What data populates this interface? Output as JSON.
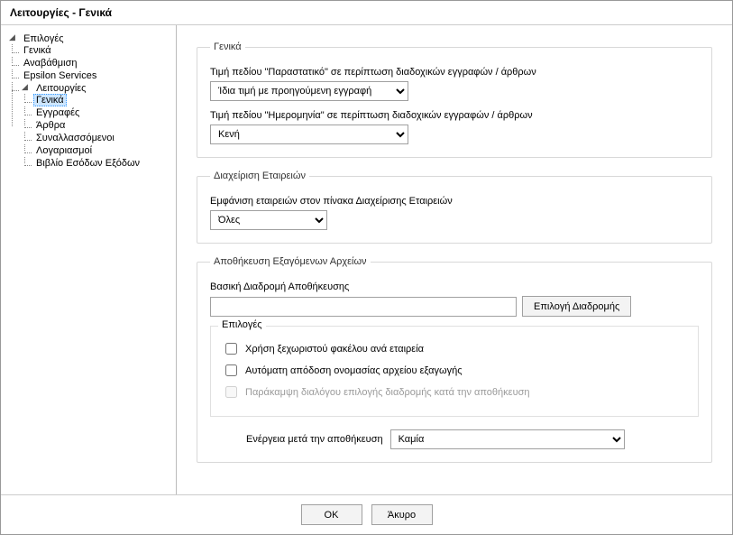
{
  "title": "Λειτουργίες - Γενικά",
  "tree": {
    "root": "Επιλογές",
    "items": {
      "genika": "Γενικά",
      "anavathmisi": "Αναβάθμιση",
      "epsilon": "Epsilon Services",
      "leitourgies": "Λειτουργίες",
      "l_genika": "Γενικά",
      "l_eggrafes": "Εγγραφές",
      "l_arthra": "Άρθρα",
      "l_synal": "Συναλλασσόμενοι",
      "l_logar": "Λογαριασμοί",
      "l_vivlio": "Βιβλίο Εσόδων Εξόδων"
    }
  },
  "general": {
    "legend": "Γενικά",
    "parastatiko_label": "Τιμή πεδίου \"Παραστατικό\" σε περίπτωση διαδοχικών εγγραφών / άρθρων",
    "parastatiko_value": "Ίδια τιμή με προηγούμενη εγγραφή",
    "imerominia_label": "Τιμή πεδίου \"Ημερομηνία\" σε περίπτωση διαδοχικών εγγραφών / άρθρων",
    "imerominia_value": "Κενή"
  },
  "companies": {
    "legend": "Διαχείριση Εταιρειών",
    "show_label": "Εμφάνιση εταιρειών στον πίνακα Διαχείρισης Εταιρειών",
    "show_value": "Όλες"
  },
  "export": {
    "legend": "Αποθήκευση Εξαγόμενων Αρχείων",
    "path_label": "Βασική Διαδρομή Αποθήκευσης",
    "path_value": "",
    "browse_label": "Επιλογή Διαδρομής",
    "options_legend": "Επιλογές",
    "chk_folder": "Χρήση ξεχωριστού φακέλου ανά εταιρεία",
    "chk_autoname": "Αυτόματη απόδοση ονομασίας αρχείου εξαγωγής",
    "chk_bypass": "Παράκαμψη διαλόγου επιλογής διαδρομής κατά την αποθήκευση",
    "action_label": "Ενέργεια μετά την αποθήκευση",
    "action_value": "Καμία"
  },
  "footer": {
    "ok": "OK",
    "cancel": "Άκυρο"
  }
}
